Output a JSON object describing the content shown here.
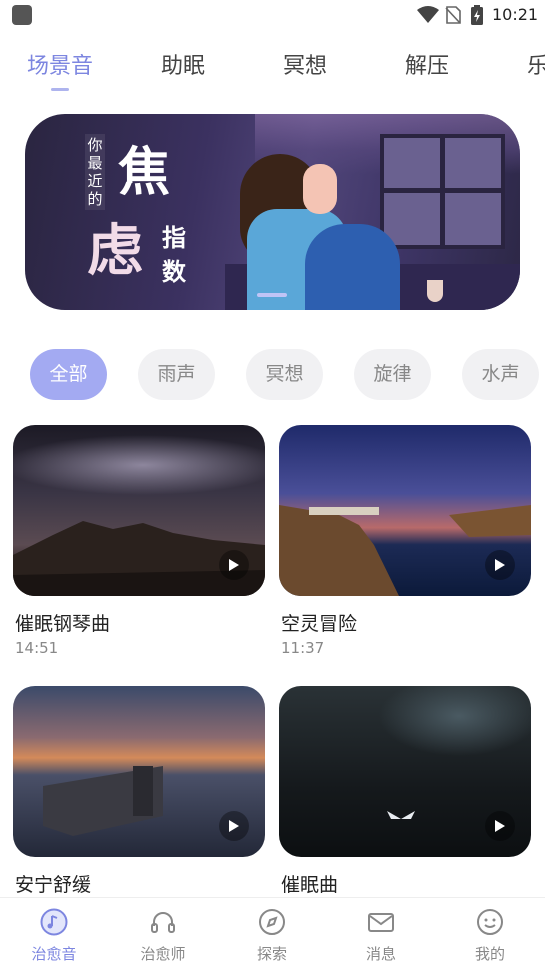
{
  "status_bar": {
    "time": "10:21"
  },
  "tabs": [
    {
      "label": "场景音",
      "active": true
    },
    {
      "label": "助眠",
      "active": false
    },
    {
      "label": "冥想",
      "active": false
    },
    {
      "label": "解压",
      "active": false
    },
    {
      "label": "乐",
      "active": false
    }
  ],
  "banner": {
    "small_text": "你最近的",
    "big_1": "焦",
    "big_2": "虑",
    "big_3": "指",
    "big_4": "数"
  },
  "filters": [
    {
      "label": "全部",
      "active": true
    },
    {
      "label": "雨声",
      "active": false
    },
    {
      "label": "冥想",
      "active": false
    },
    {
      "label": "旋律",
      "active": false
    },
    {
      "label": "水声",
      "active": false
    }
  ],
  "tracks": [
    {
      "title": "催眠钢琴曲",
      "duration": "14:51"
    },
    {
      "title": "空灵冒险",
      "duration": "11:37"
    },
    {
      "title": "安宁舒缓",
      "duration": ""
    },
    {
      "title": "催眠曲",
      "duration": ""
    }
  ],
  "bottom_nav": [
    {
      "label": "治愈音",
      "icon": "music-note-icon",
      "active": true
    },
    {
      "label": "治愈师",
      "icon": "headphones-icon",
      "active": false
    },
    {
      "label": "探索",
      "icon": "compass-icon",
      "active": false
    },
    {
      "label": "消息",
      "icon": "mail-icon",
      "active": false
    },
    {
      "label": "我的",
      "icon": "smiley-icon",
      "active": false
    }
  ],
  "colors": {
    "accent": "#7d86e0",
    "chip_active": "#a3aaf2",
    "chip_inactive": "#f1f1f3"
  }
}
